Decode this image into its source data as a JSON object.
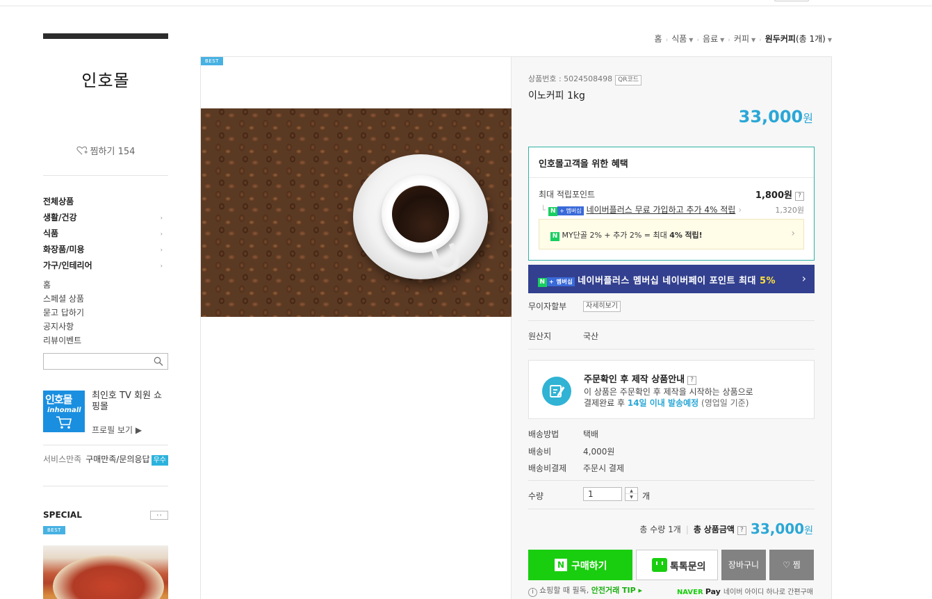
{
  "store": {
    "name": "인호몰",
    "zzim_label": "찜하기",
    "zzim_count": "154",
    "categories": [
      {
        "label": "전체상품",
        "has_sub": false
      },
      {
        "label": "생활/건강",
        "has_sub": true
      },
      {
        "label": "식품",
        "has_sub": true
      },
      {
        "label": "화장품/미용",
        "has_sub": true
      },
      {
        "label": "가구/인테리어",
        "has_sub": true
      }
    ],
    "links": [
      "홈",
      "스페셜 상품",
      "묻고 답하기",
      "공지사항",
      "리뷰이벤트"
    ],
    "search_placeholder": "",
    "profile": {
      "logo_text": "인호몰",
      "logo_sub": "inhomall",
      "name": "최인호 TV 회원 쇼핑몰",
      "view_label": "프로필 보기 ▶"
    },
    "service": {
      "label": "서비스만족",
      "value": "구매만족/문의응답",
      "badge": "우수"
    },
    "special": {
      "title": "SPECIAL",
      "tag": "BEST",
      "nav": "‹ ›"
    }
  },
  "breadcrumb": {
    "items": [
      "홈",
      "식품",
      "음료",
      "커피"
    ],
    "current": "원두커피",
    "current_count": "(총 1개)"
  },
  "product": {
    "best_tag": "BEST",
    "number_label": "상품번호 : 5024508498",
    "qr_label": "QR코드",
    "name": "이노커피 1kg",
    "price": "33,000",
    "won": "원"
  },
  "benefit": {
    "title": "인호몰고객을 위한 혜택",
    "max_label": "최대 적립포인트",
    "max_value": "1,800원",
    "help": "?",
    "np_badge_n": "N",
    "np_badge_plus": "+ 멤버십",
    "np_text": "네이버플러스 무료 가입하고 추가 4% 적립",
    "np_value": "1,320원",
    "my_text_a": "MY단골 2% + 추가 2% = 최대",
    "my_text_b": "4%",
    "my_text_c": "적립!",
    "banner_text": "네이버플러스 멤버십 네이버페이 포인트 최대",
    "banner_pct": "5%"
  },
  "rows": {
    "installment_label": "무이자할부",
    "installment_btn": "자세히보기",
    "origin_label": "원산지",
    "origin_value": "국산"
  },
  "made_to_order": {
    "title": "주문확인 후 제작 상품안내",
    "line1": "이 상품은 주문확인 후 제작을 시작하는 상품으로",
    "line2_a": "결제완료 후",
    "line2_b": "14일 이내 발송예정",
    "line2_c": "(영업일 기준)"
  },
  "shipping": {
    "method_label": "배송방법",
    "method_value": "택배",
    "fee_label": "배송비",
    "fee_value": "4,000원",
    "pay_label": "배송비결제",
    "pay_value": "주문시 결제"
  },
  "quantity": {
    "label": "수량",
    "value": "1",
    "unit": "개"
  },
  "total": {
    "qty_text": "총 수량 1개",
    "price_label_a": "총",
    "price_label_b": "상품금액",
    "price": "33,000",
    "won": "원"
  },
  "buttons": {
    "buy": "구매하기",
    "talk": "톡톡문의",
    "cart": "장바구니",
    "zzim": "♡ 찜"
  },
  "tip": {
    "pre": "쇼핑할 때 필독,",
    "strong": "안전거래 TIP ▸"
  },
  "npay": {
    "naver": "NAVER",
    "pay": "Pay",
    "text": "네이버 아이디 하나로 간편구매"
  },
  "colors": {
    "accent": "#2ba7d6",
    "naver_green": "#19ce0f",
    "banner": "#33408f"
  }
}
